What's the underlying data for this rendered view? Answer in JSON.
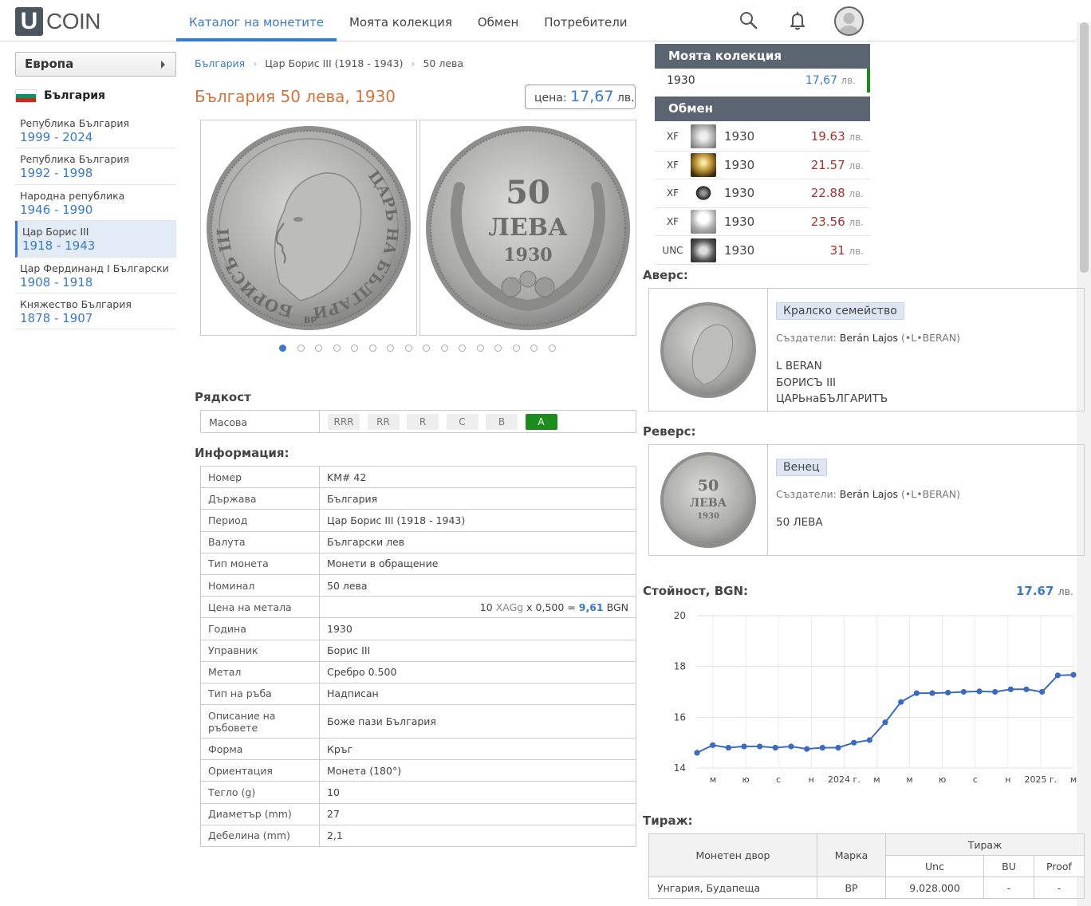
{
  "header": {
    "logo_letter": "U",
    "logo_text": "COIN",
    "nav": [
      "Каталог на монетите",
      "Моята колекция",
      "Обмен",
      "Потребители"
    ]
  },
  "sidebar": {
    "region": "Европа",
    "country": "България",
    "periods": [
      {
        "name": "Република България",
        "years": "1999 - 2024"
      },
      {
        "name": "Република България",
        "years": "1992 - 1998"
      },
      {
        "name": "Народна република",
        "years": "1946 - 1990"
      },
      {
        "name": "Цар Борис III",
        "years": "1918 - 1943"
      },
      {
        "name": "Цар Фердинанд I Български",
        "years": "1908 - 1918"
      },
      {
        "name": "Княжество България",
        "years": "1878 - 1907"
      }
    ]
  },
  "breadcrumb": [
    "България",
    "Цар Борис III (1918 - 1943)",
    "50 лева"
  ],
  "title": "България 50 лева, 1930",
  "price": {
    "label": "цена:",
    "value": "17,67",
    "unit": "лв."
  },
  "coin_obverse_text": {
    "left": "БОРИСЪ III",
    "right": "ЦАРЬ НА БЪЛГАРИТЪ",
    "mint": "BP"
  },
  "coin_reverse_text": {
    "value": "50",
    "unit": "ЛЕВА",
    "year": "1930"
  },
  "gallery": {
    "dot_count": 16,
    "active": 0
  },
  "rarity": {
    "title": "Рядкост",
    "label": "Масова",
    "grades": [
      "RRR",
      "RR",
      "R",
      "C",
      "B",
      "A"
    ],
    "active": "A"
  },
  "info": {
    "title": "Информация:",
    "rows": [
      {
        "k": "Номер",
        "v": "KM# 42"
      },
      {
        "k": "Държава",
        "v": "България"
      },
      {
        "k": "Период",
        "v": "Цар Борис III (1918 - 1943)"
      },
      {
        "k": "Валута",
        "v": "Български лев"
      },
      {
        "k": "Тип монета",
        "v": "Монети в обращение"
      },
      {
        "k": "Номинал",
        "v": "50 лева"
      },
      {
        "k": "Цена на метала",
        "v": ""
      },
      {
        "k": "Година",
        "v": "1930"
      },
      {
        "k": "Управник",
        "v": "Борис III"
      },
      {
        "k": "Метал",
        "v": "Сребро 0.500"
      },
      {
        "k": "Тип на ръба",
        "v": "Надписан"
      },
      {
        "k": "Описание на ръбовете",
        "v": "Боже пази България"
      },
      {
        "k": "Форма",
        "v": "Кръг"
      },
      {
        "k": "Ориентация",
        "v": "Монета (180°)"
      },
      {
        "k": "Тегло (g)",
        "v": "10"
      },
      {
        "k": "Диаметър (mm)",
        "v": "27"
      },
      {
        "k": "Дебелина (mm)",
        "v": "2,1"
      }
    ],
    "metal_price": {
      "qty": "10",
      "unit": "XAGg",
      "mult": "x 0,500 =",
      "value": "9,61",
      "currency": "BGN"
    }
  },
  "collection": {
    "title": "Моята колекция",
    "year": "1930",
    "price": "17,67",
    "unit": "лв."
  },
  "exchange": {
    "title": "Обмен",
    "unit": "лв.",
    "rows": [
      {
        "grade": "XF",
        "year": "1930",
        "price": "19.63"
      },
      {
        "grade": "XF",
        "year": "1930",
        "price": "21.57"
      },
      {
        "grade": "XF",
        "year": "1930",
        "price": "22.88"
      },
      {
        "grade": "XF",
        "year": "1930",
        "price": "23.56"
      },
      {
        "grade": "UNC",
        "year": "1930",
        "price": "31"
      }
    ]
  },
  "obverse": {
    "title": "Аверс:",
    "tag": "Кралско семейство",
    "creators_label": "Създатели:",
    "creators_name": "Berán Lajos",
    "creators_extra": "(•L•BERAN)",
    "lines": [
      "L BERAN",
      "БОРИСЪ III",
      "ЦАРЬнаБЪЛГАРИТЪ"
    ]
  },
  "reverse": {
    "title": "Реверс:",
    "tag": "Венец",
    "creators_label": "Създатели:",
    "creators_name": "Berán Lajos",
    "creators_extra": "(•L•BERAN)",
    "lines": [
      "50 ЛЕВА"
    ]
  },
  "value": {
    "title": "Стойност, BGN:",
    "amount": "17.67",
    "unit": "лв."
  },
  "chart_data": {
    "type": "line",
    "ylim": [
      14,
      20
    ],
    "yticks": [
      14,
      16,
      18,
      20
    ],
    "xtick_labels": [
      "м",
      "ю",
      "с",
      "н",
      "2024 г.",
      "м",
      "м",
      "ю",
      "с",
      "н",
      "2025 г.",
      "м"
    ],
    "values": [
      14.6,
      14.9,
      14.8,
      14.85,
      14.85,
      14.8,
      14.85,
      14.75,
      14.8,
      14.8,
      15.0,
      15.1,
      15.8,
      16.6,
      16.95,
      16.95,
      16.97,
      17.0,
      17.02,
      17.0,
      17.1,
      17.1,
      17.0,
      17.65,
      17.67
    ],
    "grid": true,
    "color": "#3a6bc0"
  },
  "mintage": {
    "title": "Тираж:",
    "headers": {
      "mint": "Монетен двор",
      "mark": "Марка",
      "group": "Тираж",
      "unc": "Unc",
      "bu": "BU",
      "proof": "Proof"
    },
    "rows": [
      {
        "mint": "Унгария, Будапеща",
        "mark": "BP",
        "unc": "9.028.000",
        "bu": "-",
        "proof": "-"
      }
    ]
  },
  "colors": {
    "accent": "#3a7bc8",
    "title": "#d9733a",
    "panel": "#5a6571",
    "green": "#1c8c1c",
    "exchange_price": "#b03030"
  }
}
